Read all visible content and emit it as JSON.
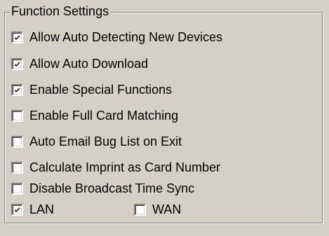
{
  "group": {
    "title": "Function Settings"
  },
  "options": [
    {
      "label": "Allow Auto Detecting New Devices",
      "checked": true
    },
    {
      "label": "Allow Auto Download",
      "checked": true
    },
    {
      "label": "Enable Special Functions",
      "checked": true
    },
    {
      "label": "Enable Full Card Matching",
      "checked": false
    },
    {
      "label": "Auto Email Bug List on Exit",
      "checked": false
    },
    {
      "label": "Calculate Imprint as Card Number",
      "checked": false
    },
    {
      "label": "Disable Broadcast Time Sync",
      "checked": false
    }
  ],
  "network": {
    "lan": {
      "label": "LAN",
      "checked": true
    },
    "wan": {
      "label": "WAN",
      "checked": false
    }
  }
}
